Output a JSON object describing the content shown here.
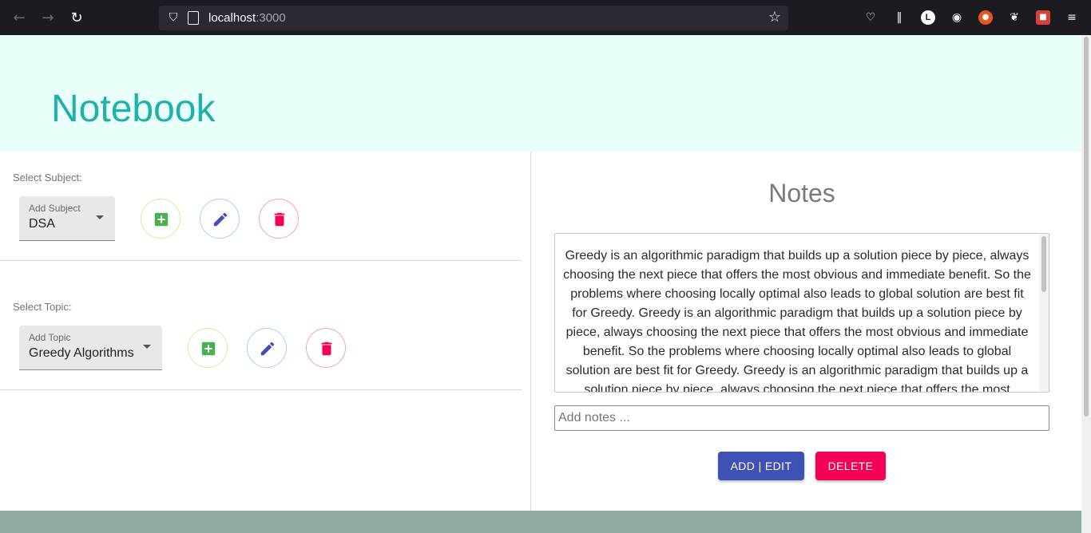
{
  "browser": {
    "url_host": "localhost",
    "url_port": ":3000"
  },
  "app": {
    "title": "Notebook"
  },
  "subject": {
    "label": "Select Subject:",
    "select_caption": "Add Subject",
    "select_value": "DSA"
  },
  "topic": {
    "label": "Select Topic:",
    "select_caption": "Add Topic",
    "select_value": "Greedy Algorithms"
  },
  "notes": {
    "title": "Notes",
    "content": "Greedy is an algorithmic paradigm that builds up a solution piece by piece, always choosing the next piece that offers the most obvious and immediate benefit. So the problems where choosing locally optimal also leads to global solution are best fit for Greedy. Greedy is an algorithmic paradigm that builds up a solution piece by piece, always choosing the next piece that offers the most obvious and immediate benefit. So the problems where choosing locally optimal also leads to global solution are best fit for Greedy. Greedy is an algorithmic paradigm that builds up a solution piece by piece, always choosing the next piece that offers the most obvious and immediate benefit.",
    "input_placeholder": "Add notes ...",
    "add_edit_label": "ADD | EDIT",
    "delete_label": "DELETE"
  },
  "colors": {
    "header_bg": "#e8fffa",
    "title_color": "#20b2aa",
    "primary": "#3f51b5",
    "danger": "#f50057",
    "add_icon": "#4caf50",
    "edit_icon": "#3f51b5",
    "delete_icon": "#f50057",
    "footer_bg": "#8faaa3"
  },
  "icons": {
    "add": "add-box-icon",
    "edit": "pencil-icon",
    "delete": "trash-icon"
  }
}
